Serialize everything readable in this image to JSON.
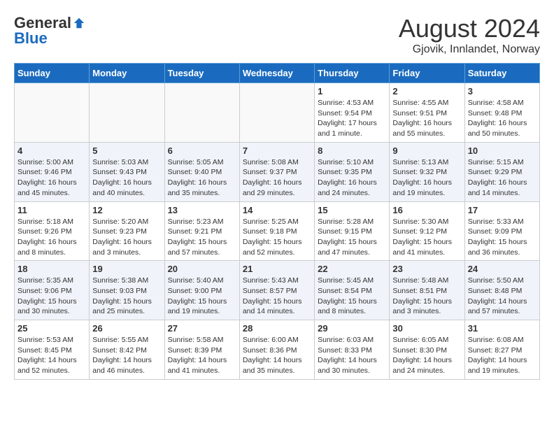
{
  "logo": {
    "general": "General",
    "blue": "Blue"
  },
  "title": "August 2024",
  "location": "Gjovik, Innlandet, Norway",
  "days_of_week": [
    "Sunday",
    "Monday",
    "Tuesday",
    "Wednesday",
    "Thursday",
    "Friday",
    "Saturday"
  ],
  "weeks": [
    [
      {
        "day": "",
        "info": ""
      },
      {
        "day": "",
        "info": ""
      },
      {
        "day": "",
        "info": ""
      },
      {
        "day": "",
        "info": ""
      },
      {
        "day": "1",
        "info": "Sunrise: 4:53 AM\nSunset: 9:54 PM\nDaylight: 17 hours and 1 minute."
      },
      {
        "day": "2",
        "info": "Sunrise: 4:55 AM\nSunset: 9:51 PM\nDaylight: 16 hours and 55 minutes."
      },
      {
        "day": "3",
        "info": "Sunrise: 4:58 AM\nSunset: 9:48 PM\nDaylight: 16 hours and 50 minutes."
      }
    ],
    [
      {
        "day": "4",
        "info": "Sunrise: 5:00 AM\nSunset: 9:46 PM\nDaylight: 16 hours and 45 minutes."
      },
      {
        "day": "5",
        "info": "Sunrise: 5:03 AM\nSunset: 9:43 PM\nDaylight: 16 hours and 40 minutes."
      },
      {
        "day": "6",
        "info": "Sunrise: 5:05 AM\nSunset: 9:40 PM\nDaylight: 16 hours and 35 minutes."
      },
      {
        "day": "7",
        "info": "Sunrise: 5:08 AM\nSunset: 9:37 PM\nDaylight: 16 hours and 29 minutes."
      },
      {
        "day": "8",
        "info": "Sunrise: 5:10 AM\nSunset: 9:35 PM\nDaylight: 16 hours and 24 minutes."
      },
      {
        "day": "9",
        "info": "Sunrise: 5:13 AM\nSunset: 9:32 PM\nDaylight: 16 hours and 19 minutes."
      },
      {
        "day": "10",
        "info": "Sunrise: 5:15 AM\nSunset: 9:29 PM\nDaylight: 16 hours and 14 minutes."
      }
    ],
    [
      {
        "day": "11",
        "info": "Sunrise: 5:18 AM\nSunset: 9:26 PM\nDaylight: 16 hours and 8 minutes."
      },
      {
        "day": "12",
        "info": "Sunrise: 5:20 AM\nSunset: 9:23 PM\nDaylight: 16 hours and 3 minutes."
      },
      {
        "day": "13",
        "info": "Sunrise: 5:23 AM\nSunset: 9:21 PM\nDaylight: 15 hours and 57 minutes."
      },
      {
        "day": "14",
        "info": "Sunrise: 5:25 AM\nSunset: 9:18 PM\nDaylight: 15 hours and 52 minutes."
      },
      {
        "day": "15",
        "info": "Sunrise: 5:28 AM\nSunset: 9:15 PM\nDaylight: 15 hours and 47 minutes."
      },
      {
        "day": "16",
        "info": "Sunrise: 5:30 AM\nSunset: 9:12 PM\nDaylight: 15 hours and 41 minutes."
      },
      {
        "day": "17",
        "info": "Sunrise: 5:33 AM\nSunset: 9:09 PM\nDaylight: 15 hours and 36 minutes."
      }
    ],
    [
      {
        "day": "18",
        "info": "Sunrise: 5:35 AM\nSunset: 9:06 PM\nDaylight: 15 hours and 30 minutes."
      },
      {
        "day": "19",
        "info": "Sunrise: 5:38 AM\nSunset: 9:03 PM\nDaylight: 15 hours and 25 minutes."
      },
      {
        "day": "20",
        "info": "Sunrise: 5:40 AM\nSunset: 9:00 PM\nDaylight: 15 hours and 19 minutes."
      },
      {
        "day": "21",
        "info": "Sunrise: 5:43 AM\nSunset: 8:57 PM\nDaylight: 15 hours and 14 minutes."
      },
      {
        "day": "22",
        "info": "Sunrise: 5:45 AM\nSunset: 8:54 PM\nDaylight: 15 hours and 8 minutes."
      },
      {
        "day": "23",
        "info": "Sunrise: 5:48 AM\nSunset: 8:51 PM\nDaylight: 15 hours and 3 minutes."
      },
      {
        "day": "24",
        "info": "Sunrise: 5:50 AM\nSunset: 8:48 PM\nDaylight: 14 hours and 57 minutes."
      }
    ],
    [
      {
        "day": "25",
        "info": "Sunrise: 5:53 AM\nSunset: 8:45 PM\nDaylight: 14 hours and 52 minutes."
      },
      {
        "day": "26",
        "info": "Sunrise: 5:55 AM\nSunset: 8:42 PM\nDaylight: 14 hours and 46 minutes."
      },
      {
        "day": "27",
        "info": "Sunrise: 5:58 AM\nSunset: 8:39 PM\nDaylight: 14 hours and 41 minutes."
      },
      {
        "day": "28",
        "info": "Sunrise: 6:00 AM\nSunset: 8:36 PM\nDaylight: 14 hours and 35 minutes."
      },
      {
        "day": "29",
        "info": "Sunrise: 6:03 AM\nSunset: 8:33 PM\nDaylight: 14 hours and 30 minutes."
      },
      {
        "day": "30",
        "info": "Sunrise: 6:05 AM\nSunset: 8:30 PM\nDaylight: 14 hours and 24 minutes."
      },
      {
        "day": "31",
        "info": "Sunrise: 6:08 AM\nSunset: 8:27 PM\nDaylight: 14 hours and 19 minutes."
      }
    ]
  ]
}
